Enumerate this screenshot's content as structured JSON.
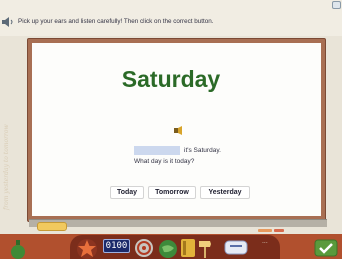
{
  "instruction": "Pick up your ears and listen carefully! Then click on the correct button.",
  "word": "Saturday",
  "sentence": {
    "line1_suffix": "it's Saturday.",
    "line2": "What day is it today?"
  },
  "answers": [
    "Today",
    "Tomorrow",
    "Yesterday"
  ],
  "toolbar": {
    "counter": "0100"
  },
  "wall_text": "...",
  "colors": {
    "title": "#2b6a27",
    "board_frame": "#a86f53",
    "bottom_bar": "#b1502e",
    "blank": "#ccd8ee"
  }
}
